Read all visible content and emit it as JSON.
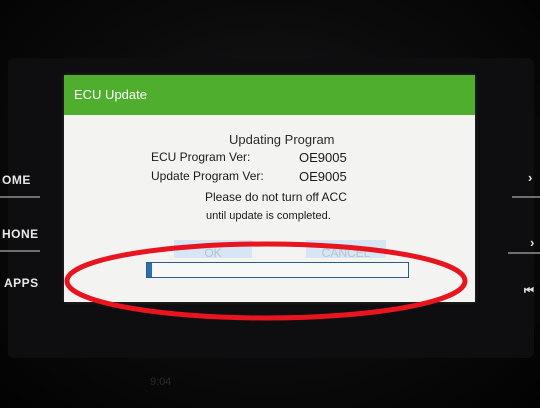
{
  "dialog": {
    "title": "ECU Update",
    "status": "Updating Program",
    "ecu_version_label": "ECU Program Ver:",
    "ecu_version_value": "OE9005",
    "update_version_label": "Update Program Ver:",
    "update_version_value": "OE9005",
    "warning_line1": "Please do not turn off ACC",
    "warning_line2": "until update is completed.",
    "ok_label": "OK",
    "cancel_label": "CANCEL",
    "progress_fraction": 0.02
  },
  "side_buttons": {
    "home": "OME",
    "phone": "HONE",
    "apps": "APPS"
  },
  "clock": "9:04",
  "colors": {
    "header": "#4fae2e",
    "progress": "#2b6fb0",
    "annotation": "#e8141e"
  },
  "icons": {
    "next": "chevron-right-icon",
    "skip_back": "skip-back-icon"
  }
}
